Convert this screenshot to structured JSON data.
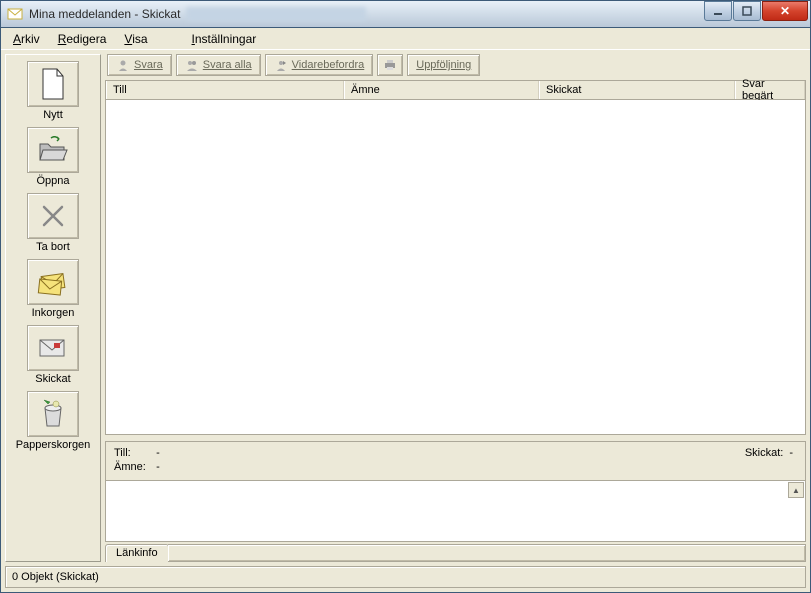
{
  "window": {
    "title": "Mina meddelanden - Skickat"
  },
  "menu": {
    "items": [
      "Arkiv",
      "Redigera",
      "Visa",
      "Inställningar"
    ]
  },
  "sidebar": {
    "items": [
      {
        "key": "nytt",
        "label": "Nytt"
      },
      {
        "key": "oppna",
        "label": "Öppna"
      },
      {
        "key": "tabort",
        "label": "Ta bort"
      },
      {
        "key": "inkorgen",
        "label": "Inkorgen"
      },
      {
        "key": "skickat",
        "label": "Skickat"
      },
      {
        "key": "papperskorgen",
        "label": "Papperskorgen"
      }
    ]
  },
  "toolbar": {
    "svara": "Svara",
    "svara_alla": "Svara alla",
    "vidare": "Vidarebefordra",
    "uppfolj": "Uppföljning"
  },
  "columns": {
    "till": "Till",
    "amne": "Ämne",
    "skickat": "Skickat",
    "svar": "Svar begärt"
  },
  "detail": {
    "till_label": "Till:",
    "till_value": "-",
    "amne_label": "Ämne:",
    "amne_value": "-",
    "skickat_label": "Skickat:",
    "skickat_value": "-"
  },
  "tab": {
    "lankinfo": "Länkinfo"
  },
  "status": {
    "text": "0 Objekt (Skickat)"
  }
}
